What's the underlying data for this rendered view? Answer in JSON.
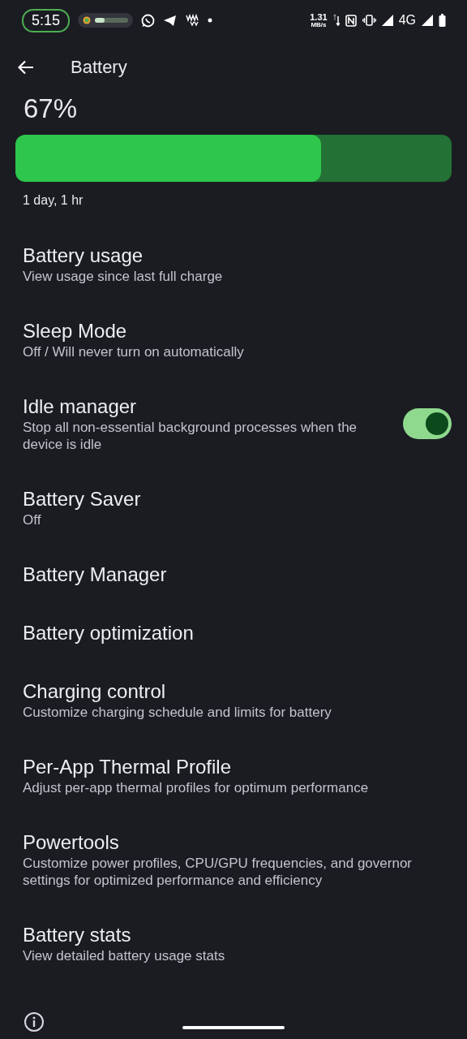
{
  "status_bar": {
    "time": "5:15",
    "progress": {
      "level": 0.3
    },
    "speed": "1.31",
    "speed_unit": "MB/s",
    "network": "4G"
  },
  "header": {
    "title": "Battery"
  },
  "battery": {
    "percent": "67%",
    "level": 0.7,
    "estimate": "1 day, 1 hr"
  },
  "items": [
    {
      "title": "Battery usage",
      "subtitle": "View usage since last full charge"
    },
    {
      "title": "Sleep Mode",
      "subtitle": "Off / Will never turn on automatically"
    },
    {
      "title": "Idle manager",
      "subtitle": "Stop all non-essential background processes when the device is idle",
      "kind": "toggle",
      "on": true
    },
    {
      "title": "Battery Saver",
      "subtitle": "Off"
    },
    {
      "title": "Battery Manager"
    },
    {
      "title": "Battery optimization"
    },
    {
      "title": "Charging control",
      "subtitle": "Customize charging schedule and limits for battery"
    },
    {
      "title": "Per-App Thermal Profile",
      "subtitle": "Adjust per-app thermal profiles for optimum performance"
    },
    {
      "title": "Powertools",
      "subtitle": "Customize power profiles, CPU/GPU frequencies, and governor settings for optimized performance and efficiency"
    },
    {
      "title": "Battery stats",
      "subtitle": "View detailed battery usage stats"
    }
  ]
}
